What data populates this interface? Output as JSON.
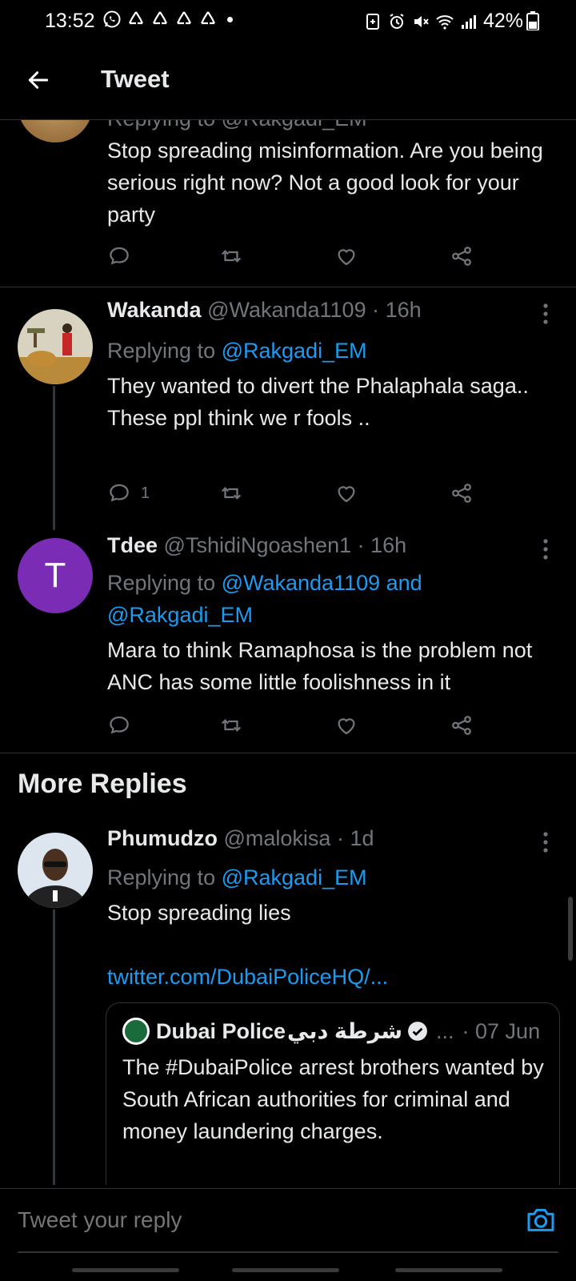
{
  "status_bar": {
    "time": "13:52",
    "battery": "42%",
    "notification_icons": [
      "whatsapp-icon",
      "recycle-icon",
      "recycle-icon",
      "recycle-icon",
      "recycle-icon"
    ],
    "right_icons": [
      "battery-saver-icon",
      "alarm-icon",
      "mute-icon",
      "wifi-icon",
      "signal-icon"
    ]
  },
  "header": {
    "title": "Tweet"
  },
  "tweets": [
    {
      "reply_partial": "Replying to @Rakgadi_EM",
      "text": "Stop spreading misinformation. Are you being serious right now? Not a good look for your party"
    },
    {
      "name": "Wakanda",
      "handle": "@Wakanda1109 · 16h",
      "replying_prefix": "Replying to ",
      "replying_to": "@Rakgadi_EM",
      "text_lines": [
        "They wanted to divert the Phalaphala saga..",
        "These ppl think we r fools .."
      ],
      "reply_count": "1"
    },
    {
      "name": "Tdee",
      "handle": "@TshidiNgoashen1 · 16h",
      "avatar_letter": "T",
      "replying_prefix": "Replying to ",
      "replying_to_1": "@Wakanda1109 and",
      "replying_to_2": "@Rakgadi_EM",
      "text": "Mara to think Ramaphosa is the problem not ANC has some little foolishness in it"
    }
  ],
  "more_replies": {
    "title": "More Replies",
    "tweet": {
      "name": "Phumudzo",
      "handle": "@malokisa · 1d",
      "replying_prefix": "Replying to ",
      "replying_to": "@Rakgadi_EM",
      "text": "Stop spreading lies",
      "link": "twitter.com/DubaiPoliceHQ/...",
      "quote": {
        "name": "Dubai Police",
        "arabic_name": "شرطة دبي",
        "ellipsis": "...",
        "date": "· 07 Jun",
        "text": "The #DubaiPolice arrest brothers wanted by South African authorities for criminal and money laundering charges."
      }
    }
  },
  "reply_bar": {
    "placeholder": "Tweet your reply"
  },
  "colors": {
    "accent": "#1d9bf0",
    "muted": "#71767b",
    "text": "#e7e9ea",
    "background": "#000000",
    "avatar_purple": "#7b2cb5"
  }
}
